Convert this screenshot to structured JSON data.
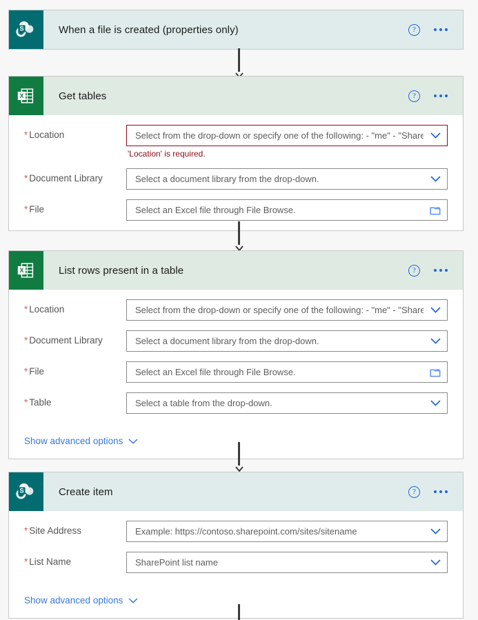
{
  "colors": {
    "page_background": "#f7f7f7",
    "sharepoint_teal": "#036c70",
    "excel_green": "#107c41",
    "sharepoint_header": "#dfeceb",
    "excel_header": "#dfeae2",
    "link_blue": "#3a7ad9",
    "error_red": "#8c0b16",
    "required_asterisk": "#d4604f",
    "connector_gray": "#3b3b3b"
  },
  "flow": {
    "cards": [
      {
        "id": "trigger-when-file-created",
        "title": "When a file is created (properties only)",
        "connector": "sharepoint",
        "icon_name": "sharepoint-icon",
        "help_label": "?",
        "fields": [],
        "advanced_label": null
      },
      {
        "id": "action-get-tables",
        "title": "Get tables",
        "connector": "excel",
        "icon_name": "excel-icon",
        "help_label": "?",
        "fields": [
          {
            "label": "Location",
            "required": true,
            "value": "Select from the drop-down or specify one of the following: - \"me\" - \"SharePoint Site URL\" - \"users/someone's UPN\" - \"groups/group Id\" - \"sites/SharePoint Site URL:/teams/team name:\" (if you want to refer to a sub-site)",
            "control": "dropdown",
            "error": "'Location' is required."
          },
          {
            "label": "Document Library",
            "required": true,
            "value": "Select a document library from the drop-down.",
            "control": "dropdown",
            "error": null
          },
          {
            "label": "File",
            "required": true,
            "value": "Select an Excel file through File Browse.",
            "control": "file-browse",
            "error": null
          }
        ],
        "advanced_label": null
      },
      {
        "id": "action-list-rows-present-in-a-table",
        "title": "List rows present in a table",
        "connector": "excel",
        "icon_name": "excel-icon",
        "help_label": "?",
        "fields": [
          {
            "label": "Location",
            "required": true,
            "value": "Select from the drop-down or specify one of the following: - \"me\" - \"SharePoint Site URL\" - \"users/someone's UPN\" - \"groups/group Id\" - \"sites/SharePoint Site URL:/teams/team name:\" (if you want to refer to a sub-site)",
            "control": "dropdown",
            "error": null
          },
          {
            "label": "Document Library",
            "required": true,
            "value": "Select a document library from the drop-down.",
            "control": "dropdown",
            "error": null
          },
          {
            "label": "File",
            "required": true,
            "value": "Select an Excel file through File Browse.",
            "control": "file-browse",
            "error": null
          },
          {
            "label": "Table",
            "required": true,
            "value": "Select a table from the drop-down.",
            "control": "dropdown",
            "error": null
          }
        ],
        "advanced_label": "Show advanced options"
      },
      {
        "id": "action-create-item",
        "title": "Create item",
        "connector": "sharepoint",
        "icon_name": "sharepoint-icon",
        "help_label": "?",
        "fields": [
          {
            "label": "Site Address",
            "required": true,
            "value": "Example: https://contoso.sharepoint.com/sites/sitename",
            "control": "dropdown",
            "error": null
          },
          {
            "label": "List Name",
            "required": true,
            "value": "SharePoint list name",
            "control": "dropdown",
            "error": null
          }
        ],
        "advanced_label": "Show advanced options"
      }
    ]
  }
}
